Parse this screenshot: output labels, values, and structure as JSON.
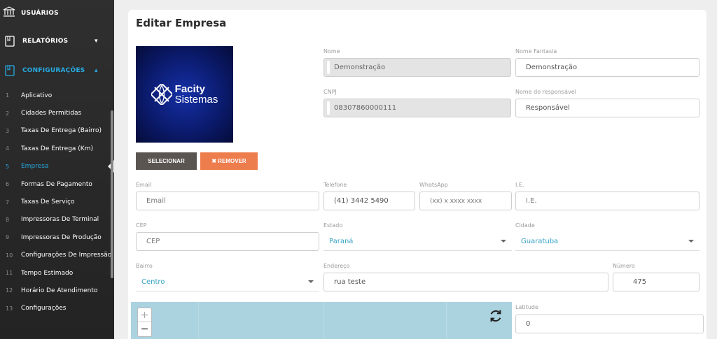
{
  "sidebar": {
    "top_item": {
      "label": "USUÁRIOS",
      "icon": "bank-icon"
    },
    "groups": [
      {
        "label": "RELATÓRIOS",
        "icon": "book-icon",
        "chevron": "▾",
        "active": false
      },
      {
        "label": "CONFIGURAÇÕES",
        "icon": "book-icon",
        "chevron": "▴",
        "active": true
      }
    ],
    "items": [
      {
        "num": "1",
        "label": "Aplicativo"
      },
      {
        "num": "2",
        "label": "Cidades Permitidas"
      },
      {
        "num": "3",
        "label": "Taxas De Entrega (Bairro)"
      },
      {
        "num": "4",
        "label": "Taxas De Entrega (Km)"
      },
      {
        "num": "5",
        "label": "Empresa"
      },
      {
        "num": "6",
        "label": "Formas De Pagamento"
      },
      {
        "num": "7",
        "label": "Taxas De Serviço"
      },
      {
        "num": "8",
        "label": "Impressoras De Terminal"
      },
      {
        "num": "9",
        "label": "Impressoras De Produção"
      },
      {
        "num": "10",
        "label": "Configurações De Impressão"
      },
      {
        "num": "11",
        "label": "Tempo Estimado"
      },
      {
        "num": "12",
        "label": "Horário De Atendimento"
      },
      {
        "num": "13",
        "label": "Configurações"
      }
    ],
    "active_item": "Empresa"
  },
  "page": {
    "title": "Editar Empresa",
    "logo": {
      "line1": "Facity",
      "line2": "Sistemas"
    },
    "buttons": {
      "select": "SELECIONAR",
      "remove": "✖ REMOVER"
    }
  },
  "form": {
    "nome": {
      "label": "Nome",
      "value": "Demonstração"
    },
    "nome_fantasia": {
      "label": "Nome Fantasia",
      "value": "Demonstração"
    },
    "cnpj": {
      "label": "CNPJ",
      "value": "08307860000111"
    },
    "responsavel": {
      "label": "Nome do responsável",
      "value": "Responsável"
    },
    "email": {
      "label": "Email",
      "placeholder": "Email"
    },
    "telefone": {
      "label": "Telefone",
      "value": "(41) 3442 5490"
    },
    "whatsapp": {
      "label": "WhatsApp",
      "placeholder": "(xx) x xxxx xxxx"
    },
    "ie": {
      "label": "I.E.",
      "placeholder": "I.E."
    },
    "cep": {
      "label": "CEP",
      "placeholder": "CEP"
    },
    "estado": {
      "label": "Estado",
      "value": "Paraná"
    },
    "cidade": {
      "label": "Cidade",
      "value": "Guaratuba"
    },
    "bairro": {
      "label": "Bairro",
      "value": "Centro"
    },
    "endereco": {
      "label": "Endereço",
      "value": "rua teste"
    },
    "numero": {
      "label": "Número",
      "value": "475"
    },
    "latitude": {
      "label": "Latitude",
      "value": "0"
    }
  },
  "map": {
    "zoom_in": "+",
    "zoom_out": "−",
    "refresh_icon": "refresh-icon"
  },
  "colors": {
    "accent": "#27aae1",
    "remove_button": "#ee7d4e",
    "select_button": "#5b5552",
    "map_water": "#aad3df"
  }
}
